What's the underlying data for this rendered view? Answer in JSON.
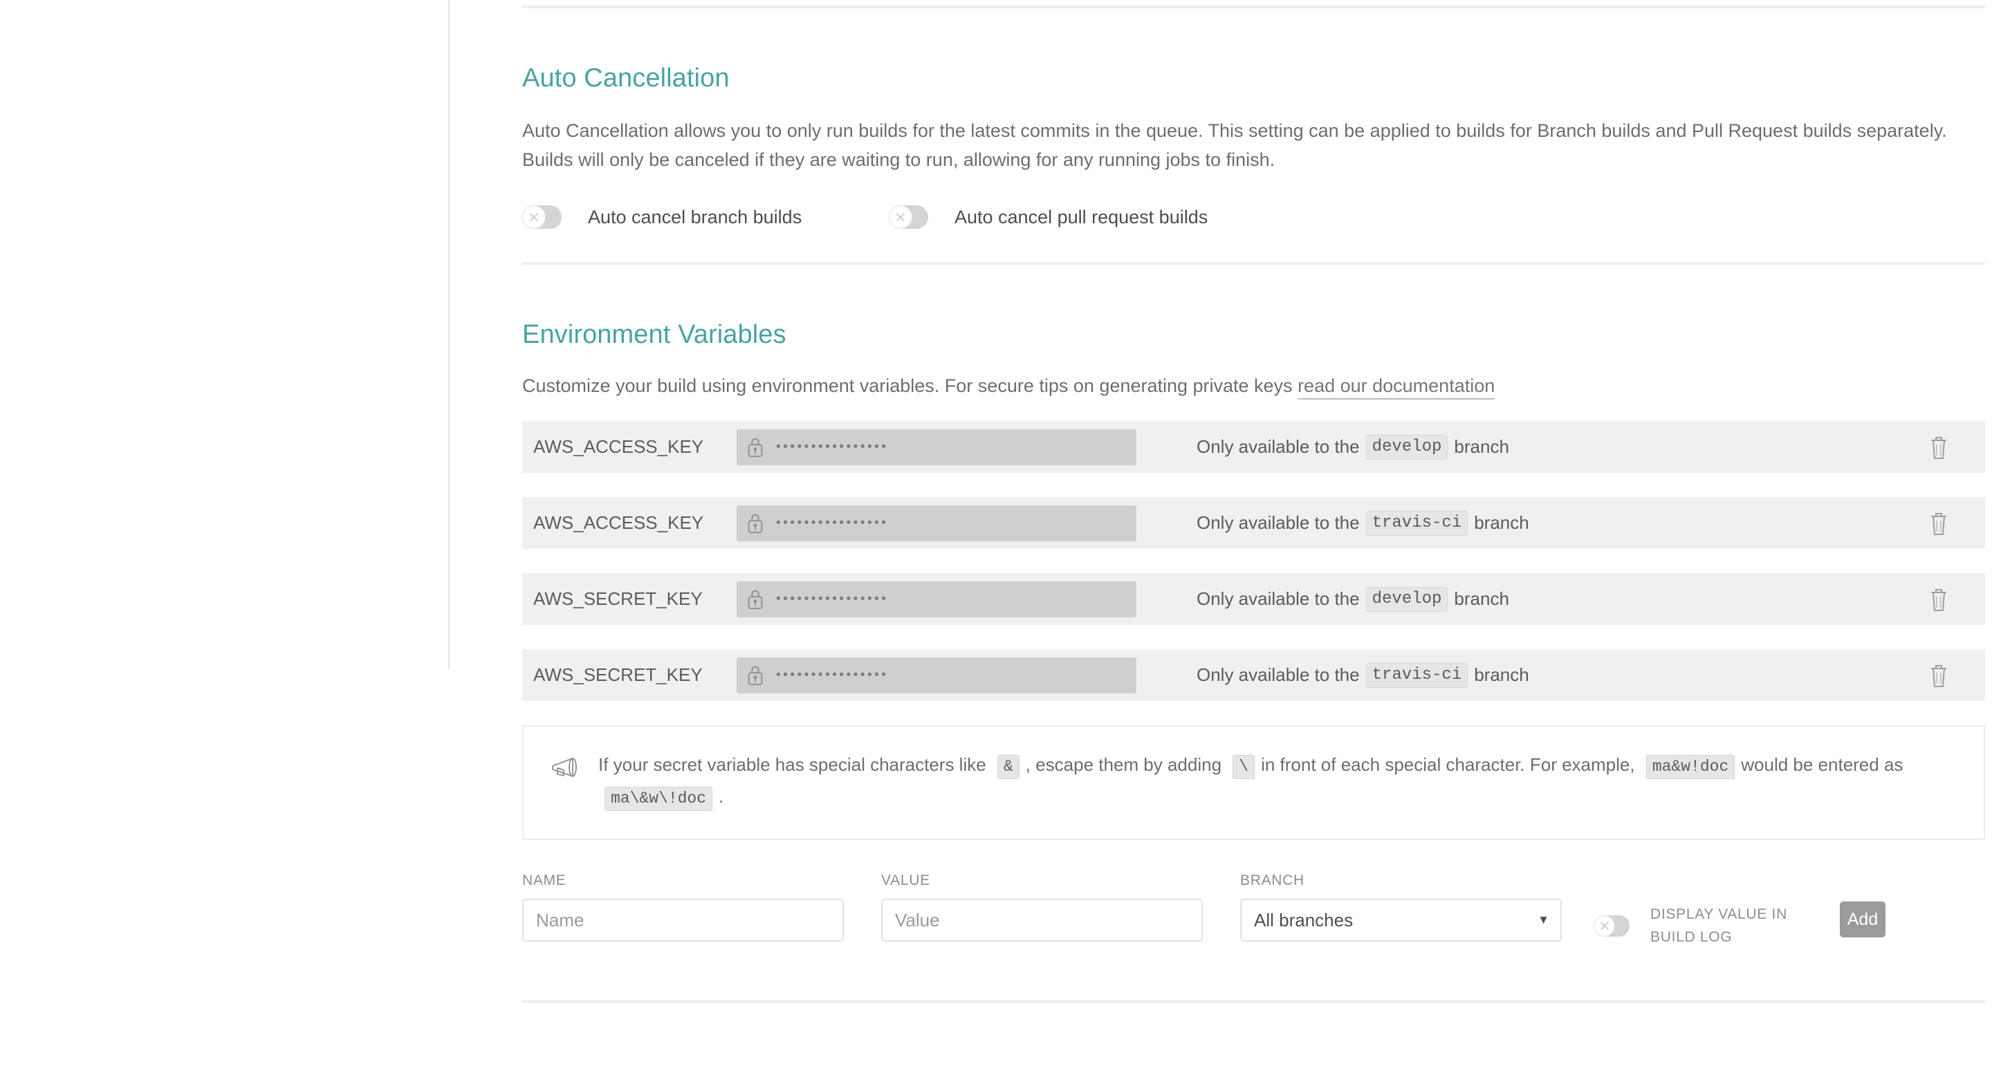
{
  "auto_cancellation": {
    "title": "Auto Cancellation",
    "description": "Auto Cancellation allows you to only run builds for the latest commits in the queue. This setting can be applied to builds for Branch builds and Pull Request builds separately. Builds will only be canceled if they are waiting to run, allowing for any running jobs to finish.",
    "toggles": [
      {
        "label": "Auto cancel branch builds",
        "state": "off"
      },
      {
        "label": "Auto cancel pull request builds",
        "state": "off"
      }
    ]
  },
  "environment_variables": {
    "title": "Environment Variables",
    "description_prefix": "Customize your build using environment variables. For secure tips on generating private keys ",
    "doc_link_text": "read our documentation",
    "rows": [
      {
        "name": "AWS_ACCESS_KEY",
        "value_masked": "••••••••••••••••",
        "branch_prefix": "Only available to the",
        "branch": "develop",
        "branch_suffix": "branch",
        "delete_icon": "trash-icon",
        "lock_icon": "lock-icon"
      },
      {
        "name": "AWS_ACCESS_KEY",
        "value_masked": "••••••••••••••••",
        "branch_prefix": "Only available to the",
        "branch": "travis-ci",
        "branch_suffix": "branch",
        "delete_icon": "trash-icon",
        "lock_icon": "lock-icon"
      },
      {
        "name": "AWS_SECRET_KEY",
        "value_masked": "••••••••••••••••",
        "branch_prefix": "Only available to the",
        "branch": "develop",
        "branch_suffix": "branch",
        "delete_icon": "trash-icon",
        "lock_icon": "lock-icon"
      },
      {
        "name": "AWS_SECRET_KEY",
        "value_masked": "••••••••••••••••",
        "branch_prefix": "Only available to the",
        "branch": "travis-ci",
        "branch_suffix": "branch",
        "delete_icon": "trash-icon",
        "lock_icon": "lock-icon"
      }
    ],
    "tip": {
      "icon": "megaphone-icon",
      "part1": "If your secret variable has special characters like",
      "code1": "&",
      "part2": ", escape them by adding",
      "code2": "\\",
      "part3": "in front of each special character. For example,",
      "code3": "ma&w!doc",
      "part4": "would be entered as",
      "code4": "ma\\&w\\!doc",
      "part5": "."
    },
    "add_form": {
      "name_label": "NAME",
      "name_placeholder": "Name",
      "name_value": "",
      "value_label": "VALUE",
      "value_placeholder": "Value",
      "value_value": "",
      "branch_label": "BRANCH",
      "branch_selected": "All branches",
      "branch_options": [
        "All branches"
      ],
      "display_toggle_label": "DISPLAY VALUE IN BUILD LOG",
      "display_toggle_state": "off",
      "add_button": "Add"
    }
  },
  "colors": {
    "accent": "#4aa3a3",
    "text": "#6d6d6d",
    "row_bg": "#f0f0f0",
    "value_bg": "#cfcfcf",
    "button_bg": "#9b9b9b"
  }
}
